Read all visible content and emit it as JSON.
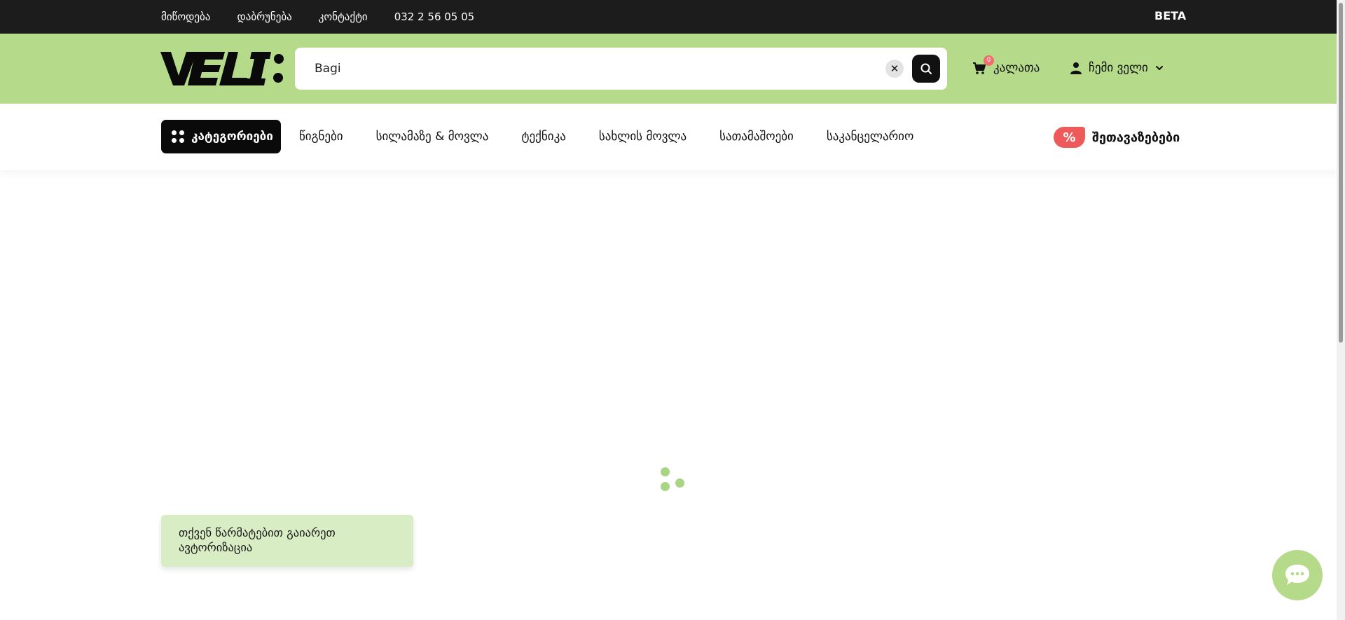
{
  "topbar": {
    "links": [
      "მიწოდება",
      "დაბრუნება",
      "კონტაქტი",
      "032 2 56 05 05"
    ],
    "beta_label": "BETA"
  },
  "header": {
    "logo_text": "VELI:",
    "search": {
      "value": "Bagi",
      "clear_icon": "close-icon",
      "submit_icon": "search-icon"
    },
    "cart": {
      "label": "კალათა",
      "count": "0",
      "icon": "cart-icon"
    },
    "account": {
      "label": "ჩემი ველი",
      "icon": "user-icon",
      "chevron_icon": "chevron-down-icon"
    }
  },
  "nav": {
    "categories_label": "კატეგორიები",
    "links": [
      "წიგნები",
      "სილამაზე & მოვლა",
      "ტექნიკა",
      "სახლის მოვლა",
      "სათამაშოები",
      "საკანცელარიო"
    ],
    "offers": {
      "badge": "%",
      "label": "შეთავაზებები"
    }
  },
  "toast": {
    "message": "თქვენ წარმატებით გაიარეთ ავტორიზაცია"
  },
  "colors": {
    "topbar_bg": "#1c1c1c",
    "brand_green": "#b5db8a",
    "toast_bg": "#d9edc5",
    "offer_red": "#ee5a5a",
    "loader_green": "#a8d584"
  }
}
